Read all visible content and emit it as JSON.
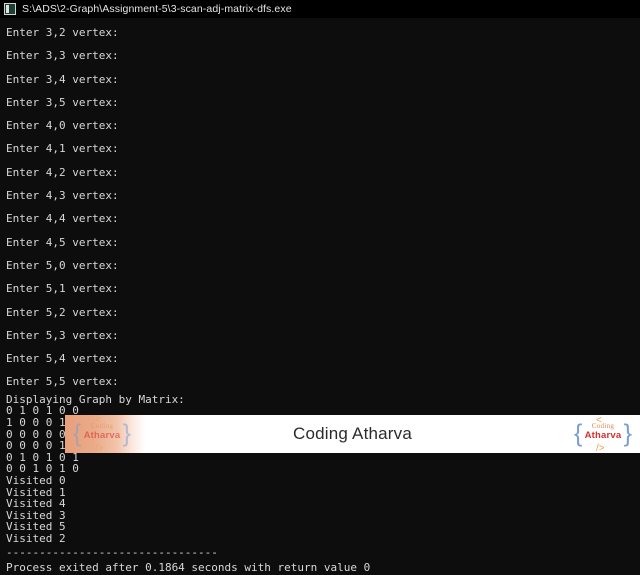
{
  "window": {
    "titlebar": {
      "icon": "console-window-icon",
      "title": "S:\\ADS\\2-Graph\\Assignment-5\\3-scan-adj-matrix-dfs.exe"
    },
    "background_color": "#0d0d0d",
    "text_color": "#d6d6d6"
  },
  "console": {
    "prompt_lines": [
      "Enter 3,2 vertex:",
      "Enter 3,3 vertex:",
      "Enter 3,4 vertex:",
      "Enter 3,5 vertex:",
      "Enter 4,0 vertex:",
      "Enter 4,1 vertex:",
      "Enter 4,2 vertex:",
      "Enter 4,3 vertex:",
      "Enter 4,4 vertex:",
      "Enter 4,5 vertex:",
      "Enter 5,0 vertex:",
      "Enter 5,1 vertex:",
      "Enter 5,2 vertex:",
      "Enter 5,3 vertex:",
      "Enter 5,4 vertex:",
      "Enter 5,5 vertex:"
    ],
    "matrix_heading": "Displaying Graph by Matrix:",
    "matrix_rows": [
      "0 1 0 1 0 0",
      "1 0 0 0 1 0",
      "0 0 0 0 0 1",
      "0 0 0 0 1 0",
      "0 1 0 1 0 1",
      "0 0 1 0 1 0"
    ],
    "visited_lines": [
      "Visited 0",
      "Visited 1",
      "Visited 4",
      "Visited 3",
      "Visited 5",
      "Visited 2"
    ],
    "separator": "--------------------------------",
    "exit_message": "Process exited after 0.1864 seconds with return value 0"
  },
  "watermark": {
    "title": "Coding Atharva",
    "logo": {
      "brace_left": "{",
      "brace_right": "}",
      "word_top": "Coding",
      "word_bottom": "Atharva",
      "angle_open": "<",
      "angle_close": "/>"
    },
    "colors": {
      "brace": "#7a9fd4",
      "coding": "#e08a52",
      "atharva": "#d2302c",
      "angle": "#e8a24a",
      "banner_tint": "#e8a07a",
      "title_text": "#2b2b2b"
    }
  }
}
